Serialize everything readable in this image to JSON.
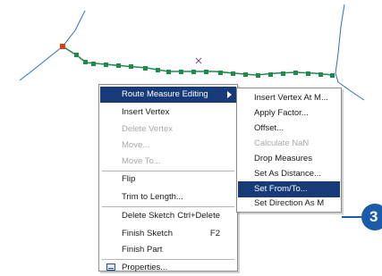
{
  "context_menu": {
    "items": [
      {
        "label": "Route Measure Editing",
        "shortcut": "",
        "state": "selected",
        "submenu": true
      },
      {
        "label": "Insert Vertex",
        "shortcut": "",
        "state": "enabled"
      },
      {
        "label": "Delete Vertex",
        "shortcut": "",
        "state": "disabled"
      },
      {
        "label": "Move...",
        "shortcut": "",
        "state": "disabled"
      },
      {
        "label": "Move To...",
        "shortcut": "",
        "state": "disabled"
      },
      {
        "label": "Flip",
        "shortcut": "",
        "state": "enabled"
      },
      {
        "label": "Trim to Length...",
        "shortcut": "",
        "state": "enabled"
      },
      {
        "label": "Delete Sketch",
        "shortcut": "Ctrl+Delete",
        "state": "enabled"
      },
      {
        "label": "Finish Sketch",
        "shortcut": "F2",
        "state": "enabled"
      },
      {
        "label": "Finish Part",
        "shortcut": "",
        "state": "enabled"
      },
      {
        "label": "Properties...",
        "shortcut": "",
        "state": "enabled",
        "icon": "properties-icon"
      }
    ]
  },
  "submenu": {
    "items": [
      {
        "label": "Insert Vertex At M...",
        "state": "enabled"
      },
      {
        "label": "Apply Factor...",
        "state": "enabled"
      },
      {
        "label": "Offset...",
        "state": "enabled"
      },
      {
        "label": "Calculate NaN",
        "state": "disabled"
      },
      {
        "label": "Drop Measures",
        "state": "enabled"
      },
      {
        "label": "Set As Distance...",
        "state": "enabled"
      },
      {
        "label": "Set From/To...",
        "state": "selected"
      },
      {
        "label": "Set Direction As M",
        "state": "enabled"
      }
    ]
  },
  "callout": {
    "label": "3"
  },
  "colors": {
    "route_line": "#2f6fc0",
    "sketch_line": "#1f8a4c",
    "start_vertex": "#e23b1a",
    "menu_highlight": "#173a78",
    "callout": "#1c5ba8"
  }
}
